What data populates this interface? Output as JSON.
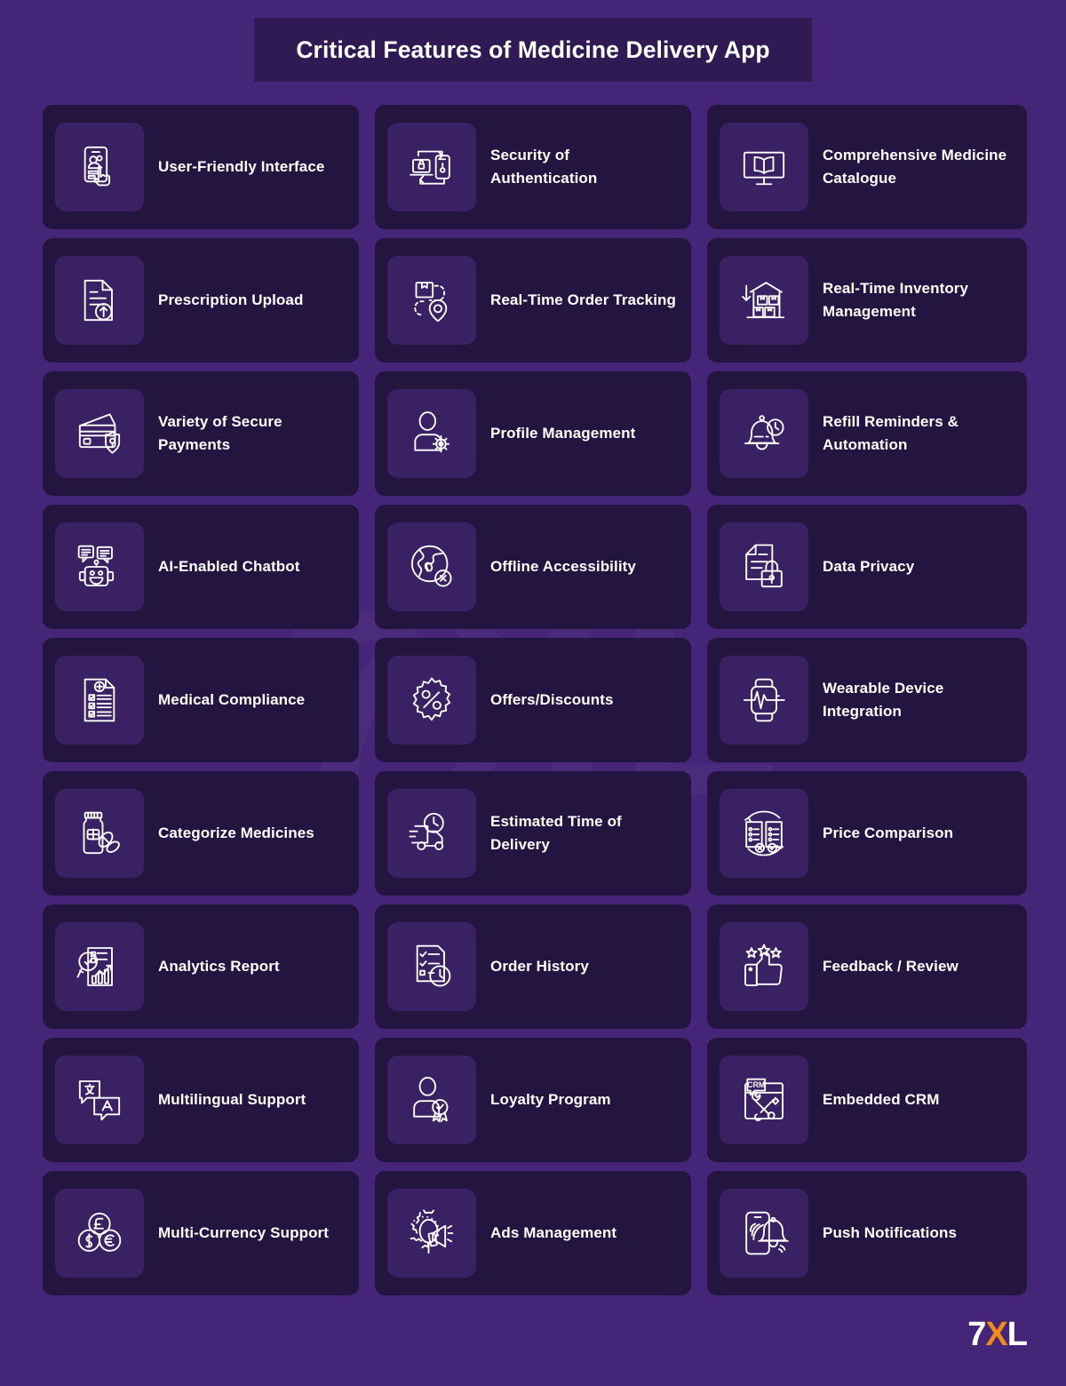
{
  "page": {
    "title": "Critical Features of Medicine Delivery App",
    "background_color": "#452578",
    "card_color": "#241440",
    "icon_tile_color": "#3a2163",
    "title_banner_color": "#301a54",
    "text_color": "#ffffff",
    "watermark_text": "7XL"
  },
  "logo": {
    "part1": "7",
    "part2": "X",
    "part3": "L",
    "accent_color": "#f28c18"
  },
  "features": [
    {
      "label": "User-Friendly Interface",
      "icon": "phone-user-touch-icon"
    },
    {
      "label": "Security of Authentication",
      "icon": "two-factor-auth-icon"
    },
    {
      "label": "Comprehensive Medicine Catalogue",
      "icon": "monitor-book-icon"
    },
    {
      "label": "Prescription Upload",
      "icon": "document-upload-icon"
    },
    {
      "label": "Real-Time Order Tracking",
      "icon": "package-route-pin-icon"
    },
    {
      "label": "Real-Time Inventory Management",
      "icon": "warehouse-boxes-icon"
    },
    {
      "label": "Variety of Secure Payments",
      "icon": "credit-card-shield-icon"
    },
    {
      "label": "Profile Management",
      "icon": "user-gear-icon"
    },
    {
      "label": "Refill Reminders & Automation",
      "icon": "bell-clock-icon"
    },
    {
      "label": "AI-Enabled Chatbot",
      "icon": "robot-chat-icon"
    },
    {
      "label": "Offline Accessibility",
      "icon": "globe-offline-icon"
    },
    {
      "label": "Data Privacy",
      "icon": "document-lock-icon"
    },
    {
      "label": "Medical Compliance",
      "icon": "checklist-medical-icon"
    },
    {
      "label": "Offers/Discounts",
      "icon": "discount-badge-icon"
    },
    {
      "label": "Wearable Device Integration",
      "icon": "smartwatch-heartbeat-icon"
    },
    {
      "label": "Categorize Medicines",
      "icon": "medicine-bottle-pills-icon"
    },
    {
      "label": "Estimated Time of Delivery",
      "icon": "delivery-truck-clock-icon"
    },
    {
      "label": "Price Comparison",
      "icon": "compare-lists-icon"
    },
    {
      "label": "Analytics Report",
      "icon": "analytics-magnifier-icon"
    },
    {
      "label": "Order History",
      "icon": "checklist-clock-icon"
    },
    {
      "label": "Feedback / Review",
      "icon": "thumbs-up-stars-icon"
    },
    {
      "label": "Multilingual Support",
      "icon": "translate-chat-icon"
    },
    {
      "label": "Loyalty Program",
      "icon": "user-award-icon"
    },
    {
      "label": "Embedded CRM",
      "icon": "crm-tools-icon"
    },
    {
      "label": "Multi-Currency Support",
      "icon": "currency-coins-icon"
    },
    {
      "label": "Ads Management",
      "icon": "gear-megaphone-icon"
    },
    {
      "label": "Push Notifications",
      "icon": "phone-bell-icon"
    }
  ]
}
